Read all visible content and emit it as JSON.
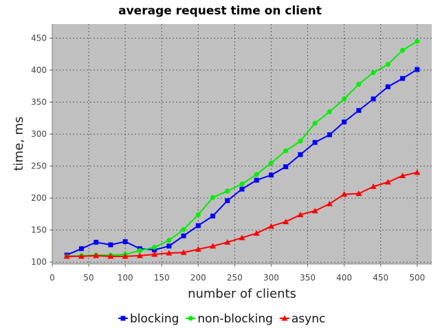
{
  "chart_data": {
    "type": "line",
    "title": "average request time on client",
    "xlabel": "number of clients",
    "ylabel": "time, ms",
    "xlim": [
      0,
      520
    ],
    "ylim": [
      97,
      472
    ],
    "x_ticks": [
      0,
      50,
      100,
      150,
      200,
      250,
      300,
      350,
      400,
      450,
      500
    ],
    "y_ticks": [
      100,
      150,
      200,
      250,
      300,
      350,
      400,
      450
    ],
    "grid": true,
    "legend_position": "bottom",
    "plot_background": "#c0c0c0",
    "x": [
      20,
      40,
      60,
      80,
      100,
      120,
      140,
      160,
      180,
      200,
      220,
      240,
      260,
      280,
      300,
      320,
      340,
      360,
      380,
      400,
      420,
      440,
      460,
      480,
      500
    ],
    "series": [
      {
        "name": "blocking",
        "color": "#0000ff",
        "marker": "square",
        "values": [
          111,
          121,
          131,
          127,
          132,
          121,
          119,
          125,
          141,
          157,
          172,
          196,
          214,
          228,
          236,
          249,
          268,
          287,
          299,
          319,
          337,
          355,
          374,
          387,
          401
        ]
      },
      {
        "name": "non-blocking",
        "color": "#00ee00",
        "marker": "circle",
        "values": [
          109,
          110,
          111,
          111,
          112,
          118,
          123,
          134,
          151,
          174,
          201,
          211,
          222,
          237,
          255,
          274,
          289,
          317,
          335,
          355,
          378,
          396,
          409,
          431,
          445
        ]
      },
      {
        "name": "async",
        "color": "#ff0000",
        "marker": "triangle",
        "values": [
          109,
          109,
          110,
          109,
          109,
          110,
          112,
          114,
          115,
          120,
          125,
          131,
          138,
          145,
          156,
          163,
          174,
          180,
          191,
          206,
          207,
          218,
          225,
          235,
          240
        ]
      }
    ]
  }
}
